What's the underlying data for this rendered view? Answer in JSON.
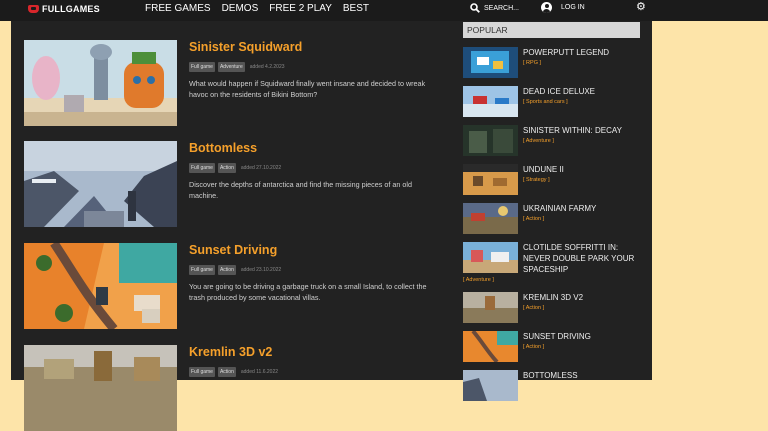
{
  "header": {
    "logo_text": "FULLGAMES",
    "nav": [
      "FREE GAMES",
      "DEMOS",
      "FREE 2 PLAY",
      "BEST"
    ],
    "search_label": "SEARCH...",
    "login_label": "LOG IN"
  },
  "games": [
    {
      "title": "Sinister Squidward",
      "tags": [
        "Full game",
        "Adventure"
      ],
      "added": "added 4.2.2023",
      "description": "What would happen if Squidward finally went insane and decided to wreak havoc on the residents of Bikini Bottom?"
    },
    {
      "title": "Bottomless",
      "tags": [
        "Full game",
        "Action"
      ],
      "added": "added 27.10.2022",
      "description": "Discover the depths of antarctica and find the missing pieces of an old machine."
    },
    {
      "title": "Sunset Driving",
      "tags": [
        "Full game",
        "Action"
      ],
      "added": "added 23.10.2022",
      "description": "You are going to be driving a garbage truck on a small Island, to collect the trash produced by some vacational villas."
    },
    {
      "title": "Kremlin 3D v2",
      "tags": [
        "Full game",
        "Action"
      ],
      "added": "added 11.6.2022",
      "description": ""
    }
  ],
  "sidebar": {
    "heading": "POPULAR",
    "items": [
      {
        "name": "POWERPUTT LEGEND",
        "category": "[ RPG ]"
      },
      {
        "name": "DEAD ICE DELUXE",
        "category": "[ Sports and cars ]"
      },
      {
        "name": "SINISTER WITHIN: DECAY",
        "category": "[ Adventure ]"
      },
      {
        "name": "UNDUNE II",
        "category": "[ Strategy ]"
      },
      {
        "name": "UKRAINIAN FARMY",
        "category": "[ Action ]"
      },
      {
        "name": "CLOTILDE SOFFRITTI IN: NEVER DOUBLE PARK YOUR SPACESHIP",
        "category": "[ Adventure ]"
      },
      {
        "name": "KREMLIN 3D V2",
        "category": "[ Action ]"
      },
      {
        "name": "SUNSET DRIVING",
        "category": "[ Action ]"
      },
      {
        "name": "BOTTOMLESS",
        "category": ""
      }
    ]
  },
  "icons": {
    "logo": "gamepad-logo-icon",
    "search": "search-icon",
    "user": "user-icon",
    "settings": "gear-icon"
  },
  "colors": {
    "accent": "#f5a02b",
    "page_bg": "#fde4a9",
    "content_bg": "#222222",
    "topbar_bg": "#1b1b1b"
  }
}
